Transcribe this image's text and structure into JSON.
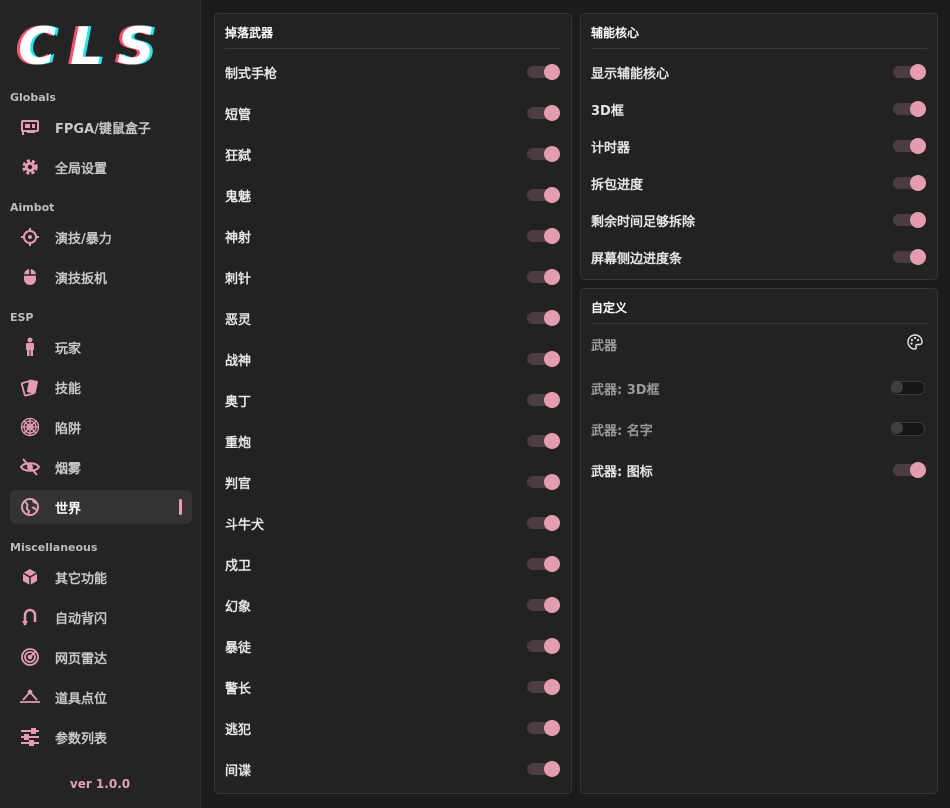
{
  "brand": {
    "logo_text": "CLS",
    "version": "ver 1.0.0"
  },
  "colors": {
    "accent": "#e39cb0",
    "background": "#1c1c1c",
    "panel": "#222222",
    "sidebar": "#242424"
  },
  "sidebar": {
    "sections": [
      {
        "title": "Globals",
        "items": [
          {
            "label": "FPGA/键鼠盒子",
            "icon": "hardware-card-icon"
          },
          {
            "label": "全局设置",
            "icon": "gear-icon"
          }
        ]
      },
      {
        "title": "Aimbot",
        "items": [
          {
            "label": "演技/暴力",
            "icon": "crosshair-icon"
          },
          {
            "label": "演技扳机",
            "icon": "mouse-icon"
          }
        ]
      },
      {
        "title": "ESP",
        "items": [
          {
            "label": "玩家",
            "icon": "person-icon"
          },
          {
            "label": "技能",
            "icon": "cards-icon"
          },
          {
            "label": "陷阱",
            "icon": "spiderweb-icon"
          },
          {
            "label": "烟雾",
            "icon": "eye-slash-icon"
          },
          {
            "label": "世界",
            "icon": "globe-icon",
            "active": true
          }
        ]
      },
      {
        "title": "Miscellaneous",
        "items": [
          {
            "label": "其它功能",
            "icon": "cube-icon"
          },
          {
            "label": "自动背闪",
            "icon": "u-turn-icon"
          },
          {
            "label": "网页雷达",
            "icon": "radar-icon"
          },
          {
            "label": "道具点位",
            "icon": "map-point-icon"
          },
          {
            "label": "参数列表",
            "icon": "sliders-icon"
          }
        ]
      }
    ]
  },
  "weapon_drop_panel": {
    "title": "掉落武器",
    "items": [
      {
        "label": "制式手枪",
        "enabled": true
      },
      {
        "label": "短管",
        "enabled": true
      },
      {
        "label": "狂弑",
        "enabled": true
      },
      {
        "label": "鬼魅",
        "enabled": true
      },
      {
        "label": "神射",
        "enabled": true
      },
      {
        "label": "刺针",
        "enabled": true
      },
      {
        "label": "恶灵",
        "enabled": true
      },
      {
        "label": "战神",
        "enabled": true
      },
      {
        "label": "奥丁",
        "enabled": true
      },
      {
        "label": "重炮",
        "enabled": true
      },
      {
        "label": "判官",
        "enabled": true
      },
      {
        "label": "斗牛犬",
        "enabled": true
      },
      {
        "label": "戍卫",
        "enabled": true
      },
      {
        "label": "幻象",
        "enabled": true
      },
      {
        "label": "暴徒",
        "enabled": true
      },
      {
        "label": "警长",
        "enabled": true
      },
      {
        "label": "逃犯",
        "enabled": true
      },
      {
        "label": "间谍",
        "enabled": true
      }
    ]
  },
  "spike_panel": {
    "title": "辅能核心",
    "items": [
      {
        "label": "显示辅能核心",
        "enabled": true
      },
      {
        "label": "3D框",
        "enabled": true
      },
      {
        "label": "计时器",
        "enabled": true
      },
      {
        "label": "拆包进度",
        "enabled": true
      },
      {
        "label": "剩余时间足够拆除",
        "enabled": true
      },
      {
        "label": "屏幕侧边进度条",
        "enabled": true
      }
    ]
  },
  "custom_panel": {
    "title": "自定义",
    "color_row_label": "武器",
    "color_icon": "palette-icon",
    "items": [
      {
        "label": "武器: 3D框",
        "enabled": false
      },
      {
        "label": "武器: 名字",
        "enabled": false
      },
      {
        "label": "武器: 图标",
        "enabled": true
      }
    ]
  }
}
